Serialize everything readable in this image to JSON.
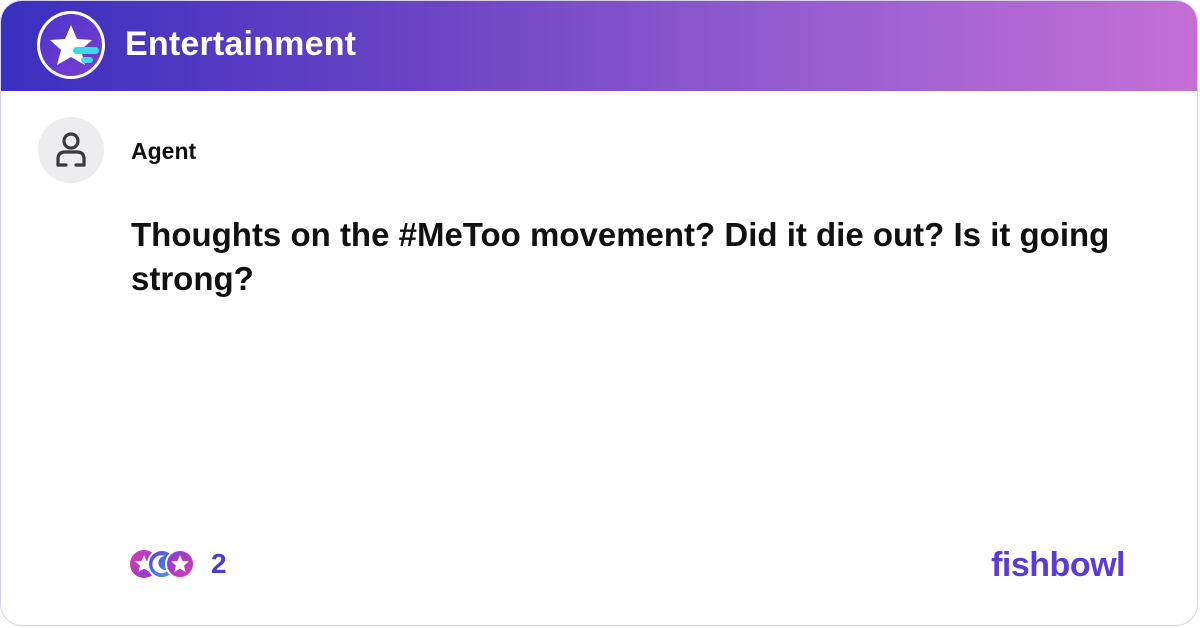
{
  "header": {
    "channel_title": "Entertainment",
    "gradient_colors": [
      "#3a2fbf",
      "#9a5fd0",
      "#c46fd6"
    ],
    "logo_icon": "star-bowl-logo-icon"
  },
  "post": {
    "author": "Agent",
    "avatar_icon": "user-icon",
    "text": "Thoughts on the #MeToo movement? Did it die out? Is it going strong?"
  },
  "footer": {
    "reaction_icons": [
      "star-reaction-icon",
      "moon-reaction-icon",
      "star-reaction-icon"
    ],
    "reaction_count": "2",
    "brand": "fishbowl",
    "brand_color": "#5a3bd8"
  }
}
